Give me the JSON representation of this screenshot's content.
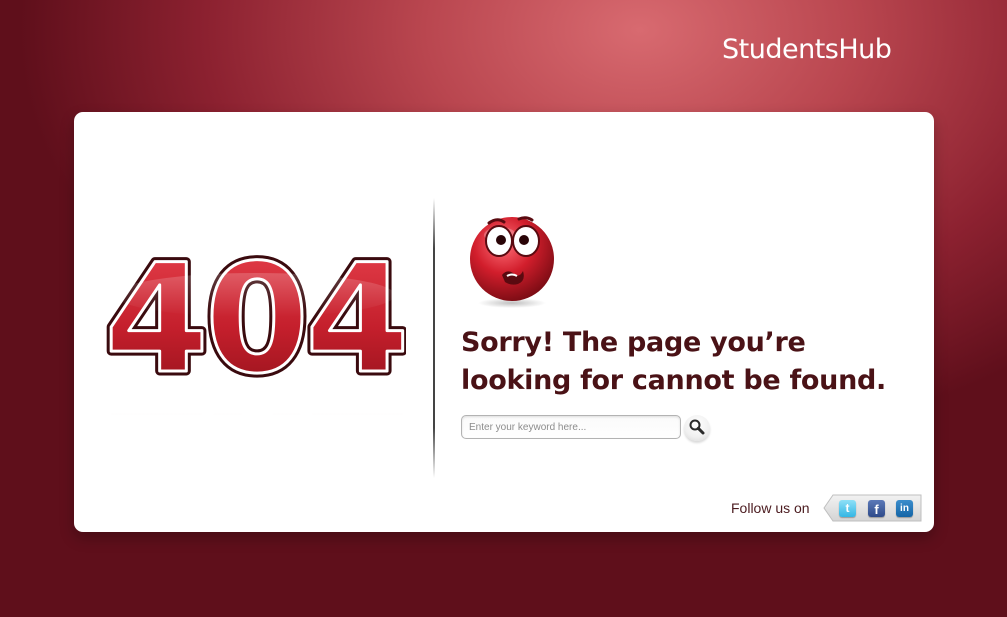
{
  "header": {
    "brand": "StudentsHub"
  },
  "error": {
    "code": "404",
    "message": "Sorry! The page you’re looking for cannot be found."
  },
  "search": {
    "placeholder": "Enter your keyword here...",
    "value": ""
  },
  "social": {
    "follow_label": "Follow us on",
    "networks": [
      {
        "name": "twitter",
        "icon": "twitter-icon",
        "glyph": "t"
      },
      {
        "name": "facebook",
        "icon": "facebook-icon",
        "glyph": "f"
      },
      {
        "name": "linkedin",
        "icon": "linkedin-icon",
        "glyph": "in"
      }
    ]
  },
  "colors": {
    "background": "#8c2130",
    "accent_red": "#c4232f",
    "text_dark": "#4a1216",
    "card": "#ffffff"
  }
}
